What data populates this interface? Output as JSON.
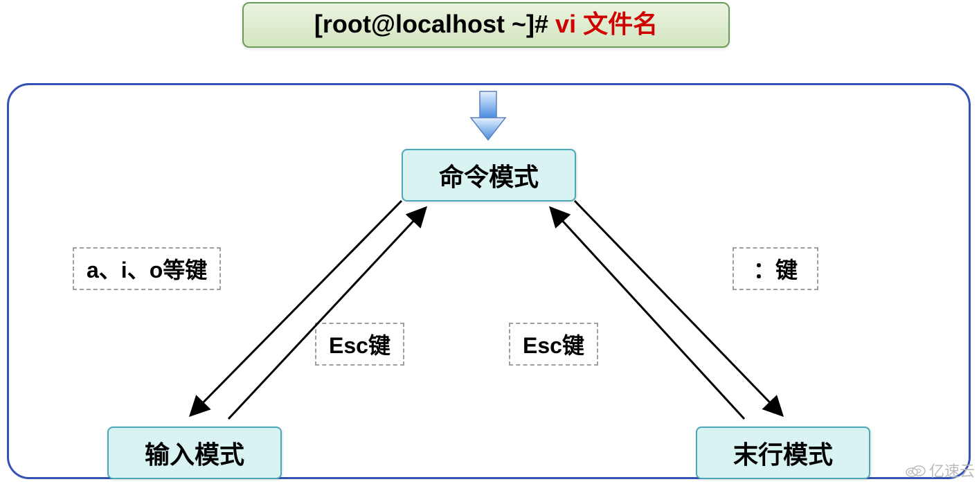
{
  "title": {
    "prompt": "[root@localhost ~]# ",
    "command": "vi 文件名"
  },
  "modes": {
    "command": "命令模式",
    "insert": "输入模式",
    "lastline": "末行模式"
  },
  "labels": {
    "insert_keys": "a、i、o等键",
    "esc_left": "Esc键",
    "esc_right": "Esc键",
    "colon_key": "：键"
  },
  "watermark": "亿速云"
}
